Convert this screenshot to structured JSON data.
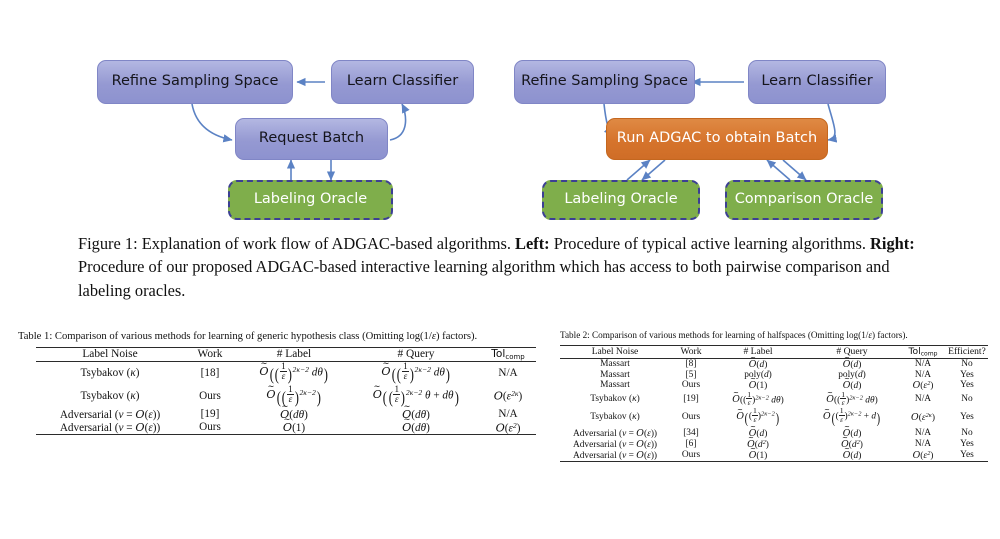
{
  "figure": {
    "left_diagram": {
      "nodes": [
        {
          "id": "refine",
          "label": "Refine Sampling Space",
          "kind": "purple"
        },
        {
          "id": "learn",
          "label": "Learn Classifier",
          "kind": "purple"
        },
        {
          "id": "request",
          "label": "Request Batch",
          "kind": "purple"
        },
        {
          "id": "oracle",
          "label": "Labeling Oracle",
          "kind": "green"
        }
      ]
    },
    "right_diagram": {
      "nodes": [
        {
          "id": "refine",
          "label": "Refine Sampling Space",
          "kind": "purple"
        },
        {
          "id": "learn",
          "label": "Learn Classifier",
          "kind": "purple"
        },
        {
          "id": "adgac",
          "label": "Run ADGAC to obtain Batch",
          "kind": "orange"
        },
        {
          "id": "label_oracle",
          "label": "Labeling Oracle",
          "kind": "green"
        },
        {
          "id": "comp_oracle",
          "label": "Comparison  Oracle",
          "kind": "green"
        }
      ]
    },
    "caption": {
      "number": "Figure 1:",
      "part1": " Explanation of work flow of ADGAC-based algorithms. ",
      "left_bold": "Left:",
      "part2": " Procedure of typical active learning algorithms. ",
      "right_bold": "Right:",
      "part3": " Procedure of our proposed ADGAC-based interactive learning algorithm which has access to both pairwise comparison and labeling oracles."
    },
    "colors": {
      "purple_fill": "#9599d2",
      "purple_border": "#8086c6",
      "orange_fill": "#d6742c",
      "green_fill": "#7fae4b",
      "green_border": "#3c3f94",
      "arrow": "#5b82c4"
    }
  },
  "table1": {
    "caption_prefix": "Table 1: Comparison of various methods for learning of generic hypothesis class (Omitting log(1/",
    "caption_eps": "ε",
    "caption_suffix": ") factors).",
    "headers": [
      "Label Noise",
      "Work",
      "# Label",
      "# Query",
      "Tol_comp"
    ],
    "header_tol_main": "Tol",
    "header_tol_sub": "comp",
    "rows": [
      {
        "noise": "Tsybakov (κ)",
        "work": "[18]",
        "work_bold": false,
        "label": "Õ( (1/ε)^{2κ−2} dθ )",
        "query": "Õ( (1/ε)^{2κ−2} dθ )",
        "tol": "N/A"
      },
      {
        "noise": "Tsybakov (κ)",
        "work": "Ours",
        "work_bold": true,
        "label": "Õ( (1/ε)^{2κ−2} )",
        "query": "Õ( (1/ε)^{2κ−2} θ + dθ )",
        "tol": "O(ε^{2κ})"
      },
      {
        "noise": "Adversarial (ν = O(ε))",
        "work": "[19]",
        "work_bold": false,
        "label": "Õ(dθ)",
        "query": "Õ(dθ)",
        "tol": "N/A"
      },
      {
        "noise": "Adversarial (ν = O(ε))",
        "work": "Ours",
        "work_bold": true,
        "label": "Õ(1)",
        "query": "Õ(dθ)",
        "tol": "O(ε^2)"
      }
    ]
  },
  "table2": {
    "caption_prefix": "Table 2: Comparison of various methods for learning of halfspaces (Omitting log(1/",
    "caption_eps": "ε",
    "caption_suffix": ") factors).",
    "headers": [
      "Label Noise",
      "Work",
      "# Label",
      "# Query",
      "Tol_comp",
      "Efficient?"
    ],
    "header_tol_main": "Tol",
    "header_tol_sub": "comp",
    "header_efficient": "Efficient?",
    "rows": [
      {
        "noise": "Massart",
        "work": "[8]",
        "work_bold": false,
        "label": "Õ(d)",
        "query": "Õ(d)",
        "tol": "N/A",
        "eff": "No"
      },
      {
        "noise": "Massart",
        "work": "[5]",
        "work_bold": false,
        "label": "poly(d)",
        "query": "poly(d)",
        "tol": "N/A",
        "eff": "Yes"
      },
      {
        "noise": "Massart",
        "work": "Ours",
        "work_bold": true,
        "label": "Õ(1)",
        "query": "Õ(d)",
        "tol": "O(ε^2)",
        "eff": "Yes"
      },
      {
        "noise": "Tsybakov (κ)",
        "work": "[19]",
        "work_bold": false,
        "label": "Õ((1/ε)^{2κ−2} dθ)",
        "query": "Õ((1/ε)^{2κ−2} dθ)",
        "tol": "N/A",
        "eff": "No"
      },
      {
        "noise": "Tsybakov (κ)",
        "work": "Ours",
        "work_bold": true,
        "label": "Õ( (1/ε)^{2κ−2} )",
        "query": "Õ( (1/ε)^{2κ−2} + d )",
        "tol": "O(ε^{2κ})",
        "eff": "Yes"
      },
      {
        "noise": "Adversarial (ν = O(ε))",
        "work": "[34]",
        "work_bold": false,
        "label": "Õ(d)",
        "query": "Õ(d)",
        "tol": "N/A",
        "eff": "No"
      },
      {
        "noise": "Adversarial (ν = O(ε))",
        "work": "[6]",
        "work_bold": false,
        "label": "Õ(d^2)",
        "query": "Õ(d^2)",
        "tol": "N/A",
        "eff": "Yes"
      },
      {
        "noise": "Adversarial (ν = O(ε))",
        "work": "Ours",
        "work_bold": true,
        "label": "Õ(1)",
        "query": "Õ(d)",
        "tol": "O(ε^2)",
        "eff": "Yes"
      }
    ]
  }
}
